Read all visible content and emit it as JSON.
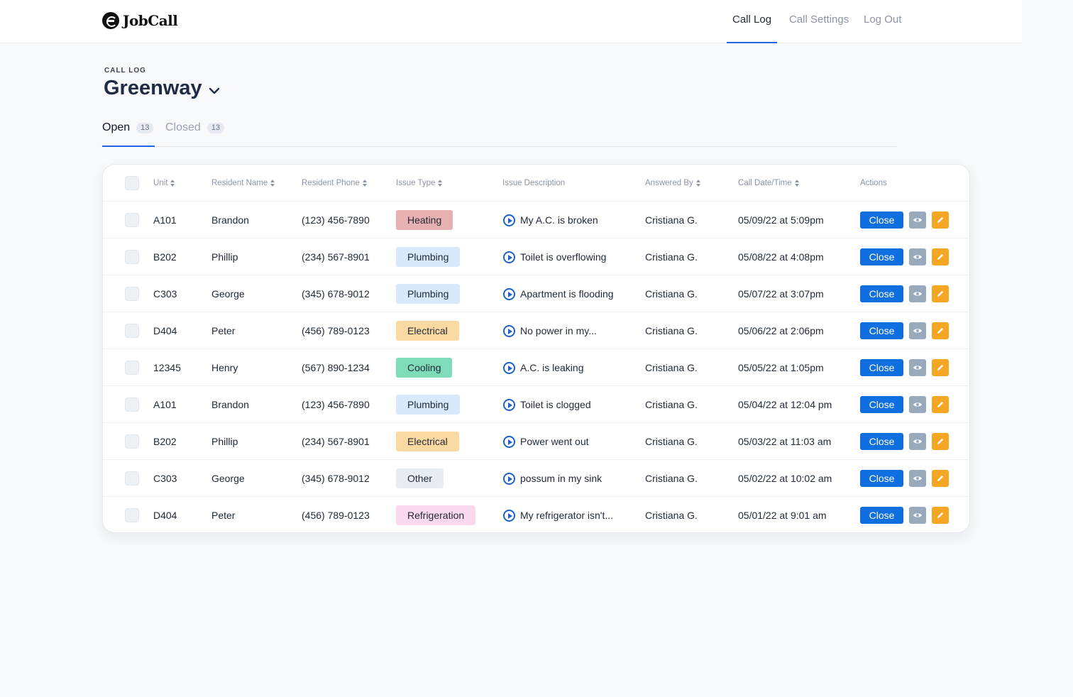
{
  "app": {
    "name": "JobCall"
  },
  "nav": {
    "items": [
      "Call Log",
      "Call Settings",
      "Log Out"
    ]
  },
  "page": {
    "eyebrow": "CALL LOG",
    "title": "Greenway"
  },
  "tabs": [
    {
      "label": "Open",
      "count": "13"
    },
    {
      "label": "Closed",
      "count": "13"
    }
  ],
  "table": {
    "columns": [
      "Unit",
      "Resident Name",
      "Resident Phone",
      "Issue Type",
      "Issue Description",
      "Answered By",
      "Call Date/Time",
      "Actions"
    ],
    "close_label": "Close",
    "rows": [
      {
        "unit": "A101",
        "name": "Brandon",
        "phone": "(123) 456-7890",
        "issue": "Heating",
        "issue_color": "#e8b1b1",
        "desc": "My A.C. is broken",
        "answered": "Cristiana G.",
        "datetime": "05/09/22 at 5:09pm"
      },
      {
        "unit": "B202",
        "name": "Phillip",
        "phone": "(234) 567-8901",
        "issue": "Plumbing",
        "issue_color": "#d7e9fb",
        "desc": "Toilet is overflowing",
        "answered": "Cristiana G.",
        "datetime": "05/08/22 at 4:08pm"
      },
      {
        "unit": "C303",
        "name": "George",
        "phone": "(345) 678-9012",
        "issue": "Plumbing",
        "issue_color": "#d7e9fb",
        "desc": "Apartment is flooding",
        "answered": "Cristiana G.",
        "datetime": "05/07/22 at 3:07pm"
      },
      {
        "unit": "D404",
        "name": "Peter",
        "phone": "(456) 789-0123",
        "issue": "Electrical",
        "issue_color": "#fbd9a2",
        "desc": "No power in my...",
        "answered": "Cristiana G.",
        "datetime": "05/06/22 at 2:06pm"
      },
      {
        "unit": "12345",
        "name": "Henry",
        "phone": "(567) 890-1234",
        "issue": "Cooling",
        "issue_color": "#7fdcb8",
        "desc": "A.C. is leaking",
        "answered": "Cristiana G.",
        "datetime": "05/05/22 at 1:05pm"
      },
      {
        "unit": "A101",
        "name": "Brandon",
        "phone": "(123) 456-7890",
        "issue": "Plumbing",
        "issue_color": "#d7e9fb",
        "desc": "Toilet is clogged",
        "answered": "Cristiana G.",
        "datetime": "05/04/22 at 12:04 pm"
      },
      {
        "unit": "B202",
        "name": "Phillip",
        "phone": "(234) 567-8901",
        "issue": "Electrical",
        "issue_color": "#fbd9a2",
        "desc": "Power went out",
        "answered": "Cristiana G.",
        "datetime": "05/03/22 at 11:03 am"
      },
      {
        "unit": "C303",
        "name": "George",
        "phone": "(345) 678-9012",
        "issue": "Other",
        "issue_color": "#e9edf3",
        "desc": "possum in my sink",
        "answered": "Cristiana G.",
        "datetime": "05/02/22 at 10:02 am"
      },
      {
        "unit": "D404",
        "name": "Peter",
        "phone": "(456) 789-0123",
        "issue": "Refrigeration",
        "issue_color": "#fbdaf0",
        "desc": "My refrigerator isn't...",
        "answered": "Cristiana G.",
        "datetime": "05/01/22 at 9:01 am"
      }
    ]
  }
}
